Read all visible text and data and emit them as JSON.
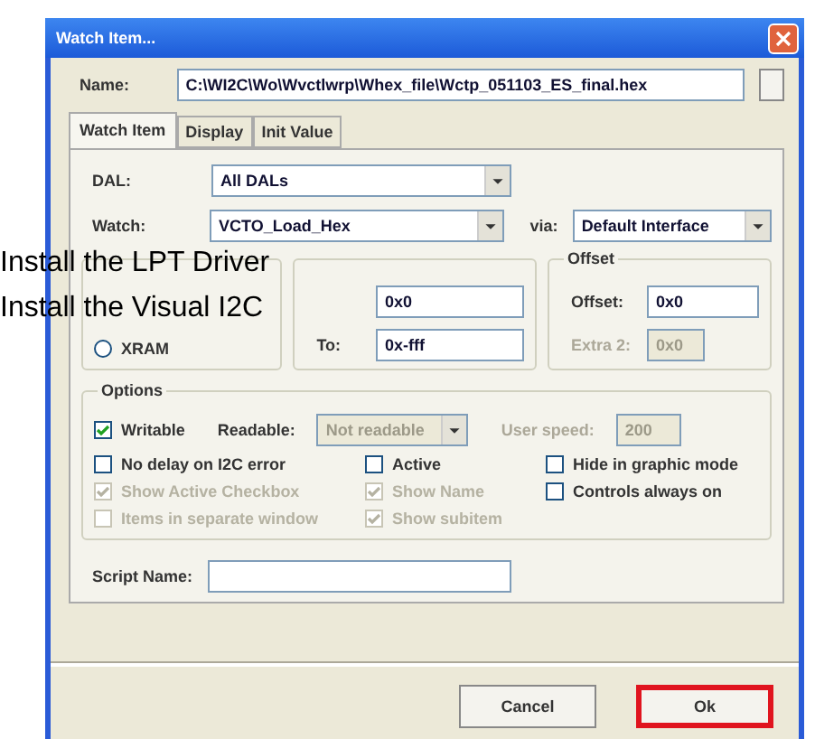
{
  "window": {
    "title": "Watch Item..."
  },
  "name": {
    "label": "Name:",
    "value": "C:\\WI2C\\Wo\\Wvctlwrp\\Whex_file\\Wctp_051103_ES_final.hex"
  },
  "tabs": [
    {
      "label": "Watch Item",
      "selected": true
    },
    {
      "label": "Display",
      "selected": false
    },
    {
      "label": "Init Value",
      "selected": false
    }
  ],
  "dal": {
    "label": "DAL:",
    "value": "All DALs"
  },
  "watch": {
    "label": "Watch:",
    "value": "VCTO_Load_Hex"
  },
  "via": {
    "label": "via:",
    "value": "Default Interface"
  },
  "address": {
    "radio": {
      "label": "XRAM",
      "selected": false
    },
    "from_value": "0x0",
    "to_label": "To:",
    "to_value": "0x-fff"
  },
  "offset": {
    "title": "Offset",
    "label": "Offset:",
    "value": "0x0",
    "extra": {
      "label": "Extra 2:",
      "value": "0x0",
      "disabled": true
    }
  },
  "options": {
    "title": "Options",
    "readable": {
      "label": "Readable:",
      "value": "Not readable",
      "disabled": true
    },
    "user_speed": {
      "label": "User speed:",
      "value": "200",
      "disabled": true
    },
    "checkboxes": [
      {
        "label": "Writable",
        "checked": true,
        "disabled": false
      },
      {
        "label": "No delay on I2C error",
        "checked": false,
        "disabled": false
      },
      {
        "label": "Active",
        "checked": false,
        "disabled": false
      },
      {
        "label": "Hide in graphic mode",
        "checked": false,
        "disabled": false
      },
      {
        "label": "Show Active Checkbox",
        "checked": true,
        "disabled": true
      },
      {
        "label": "Show Name",
        "checked": true,
        "disabled": true
      },
      {
        "label": "Controls always on",
        "checked": false,
        "disabled": false
      },
      {
        "label": "Items in separate window",
        "checked": false,
        "disabled": true
      },
      {
        "label": "Show subitem",
        "checked": true,
        "disabled": true
      }
    ]
  },
  "script": {
    "label": "Script Name:"
  },
  "buttons": [
    {
      "label": "Cancel",
      "highlighted": false
    },
    {
      "label": "Ok",
      "highlighted": true
    }
  ],
  "overlay": [
    "Install the LPT Driver",
    "Install the Visual I2C"
  ]
}
